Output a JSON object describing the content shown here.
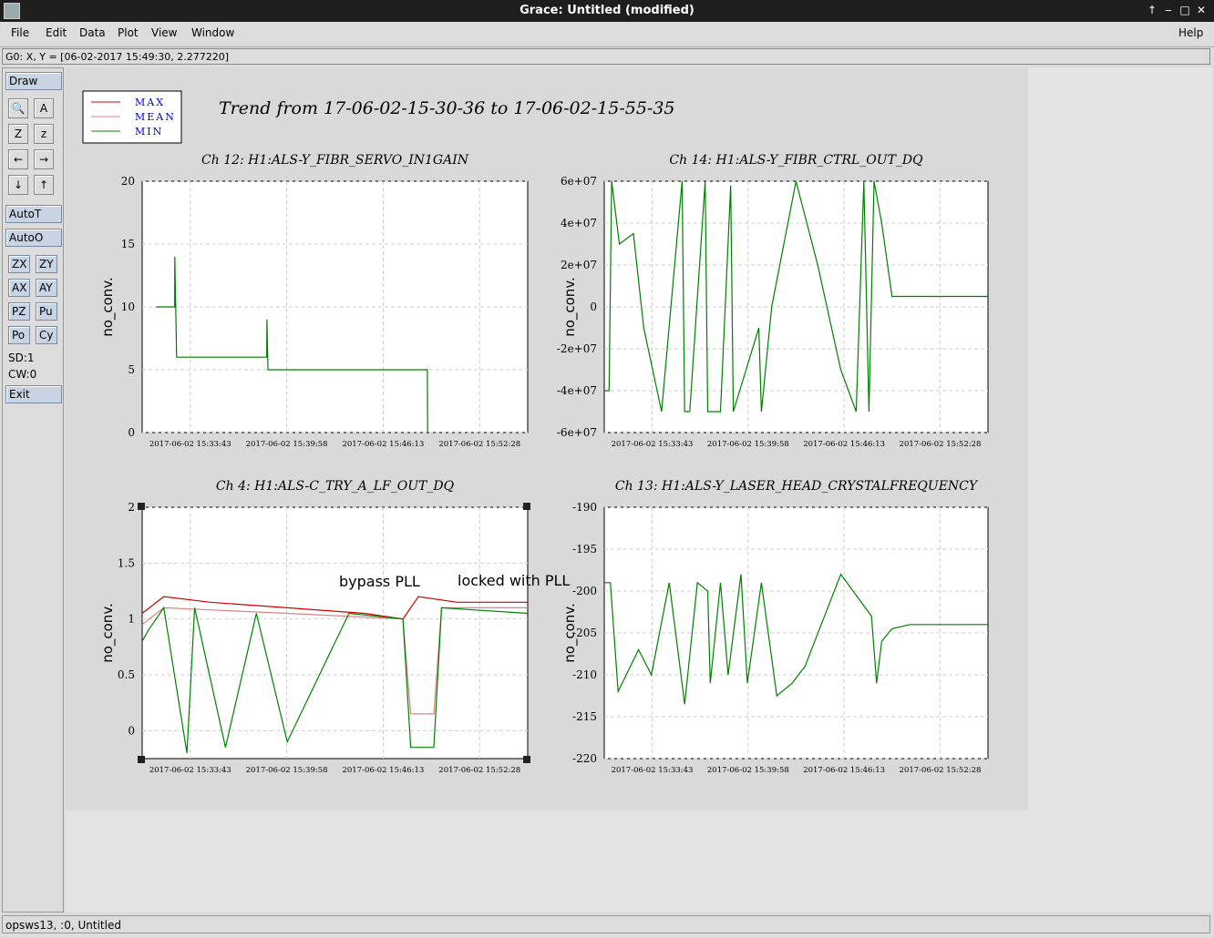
{
  "window": {
    "title": "Grace: Untitled (modified)"
  },
  "menu": {
    "file": "File",
    "edit": "Edit",
    "data": "Data",
    "plot": "Plot",
    "view": "View",
    "window": "Window",
    "help": "Help"
  },
  "locator": "G0: X, Y = [06-02-2017 15:49:30, 2.277220]",
  "tools": {
    "draw": "Draw",
    "autot": "AutoT",
    "autoo": "AutoO",
    "exit": "Exit",
    "zx": "ZX",
    "zy": "ZY",
    "ax": "AX",
    "ay": "AY",
    "pz": "PZ",
    "pu": "Pu",
    "po": "Po",
    "cy": "Cy",
    "sd": "SD:1",
    "cw": "CW:0"
  },
  "status": "opsws13, :0, Untitled",
  "plot_title": "Trend from 17-06-02-15-30-36 to 17-06-02-15-55-35",
  "legend": [
    {
      "label": "MAX",
      "color": "#d00000"
    },
    {
      "label": "MEAN",
      "color": "#e08080"
    },
    {
      "label": "MIN",
      "color": "#008000"
    }
  ],
  "annotations": {
    "bypass": "bypass PLL",
    "locked": "locked with PLL"
  },
  "chart_data": [
    {
      "type": "line",
      "title": "Ch 12: H1:ALS-Y_FIBR_SERVO_IN1GAIN",
      "ylabel": "no_conv.",
      "ylim": [
        0,
        20
      ],
      "yticks": [
        "0",
        "5",
        "10",
        "15",
        "20"
      ],
      "xticks": [
        "2017-06-02 15:33:43",
        "2017-06-02 15:39:58",
        "2017-06-02 15:46:13",
        "2017-06-02 15:52:28"
      ],
      "series": [
        {
          "name": "MIN",
          "x": [
            "15:31:30",
            "15:32:42",
            "15:32:43",
            "15:32:50",
            "15:32:51",
            "15:38:40",
            "15:38:41",
            "15:38:45",
            "15:38:46",
            "15:49:05",
            "15:49:06"
          ],
          "values": [
            10,
            10,
            14,
            6,
            6,
            6,
            9,
            5,
            5,
            5,
            0
          ]
        }
      ]
    },
    {
      "type": "line",
      "title": "Ch 14: H1:ALS-Y_FIBR_CTRL_OUT_DQ",
      "ylabel": "no_conv.",
      "ylim": [
        -60000000,
        60000000
      ],
      "yticks": [
        "-6e+07",
        "-4e+07",
        "-2e+07",
        "0",
        "2e+07",
        "4e+07",
        "6e+07"
      ],
      "xticks": [
        "2017-06-02 15:33:43",
        "2017-06-02 15:39:58",
        "2017-06-02 15:46:13",
        "2017-06-02 15:52:28"
      ],
      "series": [
        {
          "name": "MIN",
          "x": [
            "15:30:36",
            "15:30:55",
            "15:31:05",
            "15:31:35",
            "15:32:30",
            "15:33:10",
            "15:34:20",
            "15:35:40",
            "15:35:50",
            "15:36:10",
            "15:37:10",
            "15:37:20",
            "15:38:10",
            "15:38:50",
            "15:39:00",
            "15:40:40",
            "15:40:50",
            "15:41:30",
            "15:43:05",
            "15:44:30",
            "15:46:00",
            "15:47:00",
            "15:47:30",
            "15:47:50",
            "15:48:10",
            "15:48:40",
            "15:49:20",
            "15:55:35"
          ],
          "values": [
            -40000000,
            -40000000,
            60000000,
            30000000,
            35000000,
            -10000000,
            -50000000,
            60000000,
            -50000000,
            -50000000,
            60000000,
            -50000000,
            -50000000,
            58000000,
            -50000000,
            -10000000,
            -50000000,
            0,
            60000000,
            20000000,
            -30000000,
            -50000000,
            60000000,
            -50000000,
            60000000,
            40000000,
            5000000,
            5000000
          ]
        }
      ]
    },
    {
      "type": "line",
      "title": "Ch 4: H1:ALS-C_TRY_A_LF_OUT_DQ",
      "ylabel": "no_conv.",
      "ylim": [
        -0.25,
        2
      ],
      "yticks": [
        "0",
        "0.5",
        "1",
        "1.5",
        "2"
      ],
      "xticks": [
        "2017-06-02 15:33:43",
        "2017-06-02 15:39:58",
        "2017-06-02 15:46:13",
        "2017-06-02 15:52:28"
      ],
      "series": [
        {
          "name": "MAX",
          "x": [
            "15:30:36",
            "15:32:00",
            "15:35:00",
            "15:40:00",
            "15:45:00",
            "15:47:30",
            "15:48:30",
            "15:51:00",
            "15:55:35"
          ],
          "values": [
            1.05,
            1.2,
            1.15,
            1.1,
            1.05,
            1.0,
            1.2,
            1.15,
            1.15
          ]
        },
        {
          "name": "MEAN",
          "x": [
            "15:30:36",
            "15:32:00",
            "15:40:00",
            "15:47:30",
            "15:48:00",
            "15:49:30",
            "15:50:00",
            "15:55:35"
          ],
          "values": [
            0.95,
            1.1,
            1.05,
            1.0,
            0.15,
            0.15,
            1.1,
            1.1
          ]
        },
        {
          "name": "MIN",
          "x": [
            "15:30:36",
            "15:31:00",
            "15:32:00",
            "15:33:30",
            "15:34:00",
            "15:36:00",
            "15:38:00",
            "15:40:00",
            "15:44:00",
            "15:47:30",
            "15:48:00",
            "15:49:30",
            "15:50:00",
            "15:55:35"
          ],
          "values": [
            0.8,
            0.9,
            1.1,
            -0.2,
            1.1,
            -0.15,
            1.05,
            -0.1,
            1.05,
            1.0,
            -0.15,
            -0.15,
            1.1,
            1.05
          ]
        }
      ]
    },
    {
      "type": "line",
      "title": "Ch 13: H1:ALS-Y_LASER_HEAD_CRYSTALFREQUENCY",
      "ylabel": "no_conv.",
      "ylim": [
        -220,
        -190
      ],
      "yticks": [
        "-220",
        "-215",
        "-210",
        "-205",
        "-200",
        "-195",
        "-190"
      ],
      "xticks": [
        "2017-06-02 15:33:43",
        "2017-06-02 15:39:58",
        "2017-06-02 15:46:13",
        "2017-06-02 15:52:28"
      ],
      "series": [
        {
          "name": "MIN",
          "x": [
            "15:30:36",
            "15:31:00",
            "15:31:30",
            "15:32:50",
            "15:33:40",
            "15:34:50",
            "15:35:50",
            "15:36:40",
            "15:37:20",
            "15:37:30",
            "15:38:10",
            "15:38:40",
            "15:39:30",
            "15:39:55",
            "15:40:50",
            "15:41:50",
            "15:42:50",
            "15:43:40",
            "15:46:00",
            "15:48:00",
            "15:48:20",
            "15:48:40",
            "15:49:20",
            "15:50:30",
            "15:55:35"
          ],
          "values": [
            -199,
            -199,
            -212,
            -207,
            -210,
            -199,
            -213.5,
            -199,
            -200,
            -211,
            -199,
            -210,
            -198,
            -211,
            -199,
            -212.5,
            -211,
            -209,
            -198,
            -203,
            -211,
            -206,
            -204.5,
            -204,
            -204
          ]
        }
      ]
    }
  ]
}
